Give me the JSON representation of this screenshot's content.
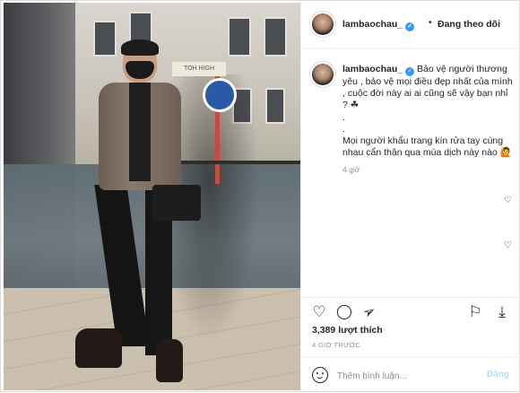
{
  "post": {
    "username": "lambaochau_",
    "follow_label": "Đang theo dõi",
    "separator": "•"
  },
  "caption": {
    "username": "lambaochau_",
    "line1": "Bảo vệ người thương yêu , bảo vệ mọi điều đẹp nhất của mình , cuộc đời này ai ai cũng sẽ vậy bạn nhỉ ? ☘",
    "dot1": ".",
    "dot2": ".",
    "line2": "Mọi người khẩu trang kín rửa tay cùng nhau cẩn thận qua mùa dịch này nào 🙋",
    "time": "4 giờ"
  },
  "photo": {
    "sign_text": "TOH HIGH"
  },
  "icons": {
    "heart": "♡",
    "comment": "◯",
    "share": "➢",
    "bookmark": "⚐",
    "download": "⤓",
    "small_heart": "♡",
    "verified": "✓"
  },
  "stats": {
    "likes": "3,389 lượt thích",
    "ago": "4 GIỜ TRƯỚC"
  },
  "comment": {
    "placeholder": "Thêm bình luận...",
    "post_label": "Đăng"
  },
  "colors": {
    "verified": "#3897f0",
    "post_disabled": "#b2dffc",
    "muted": "#8e8e8e"
  }
}
